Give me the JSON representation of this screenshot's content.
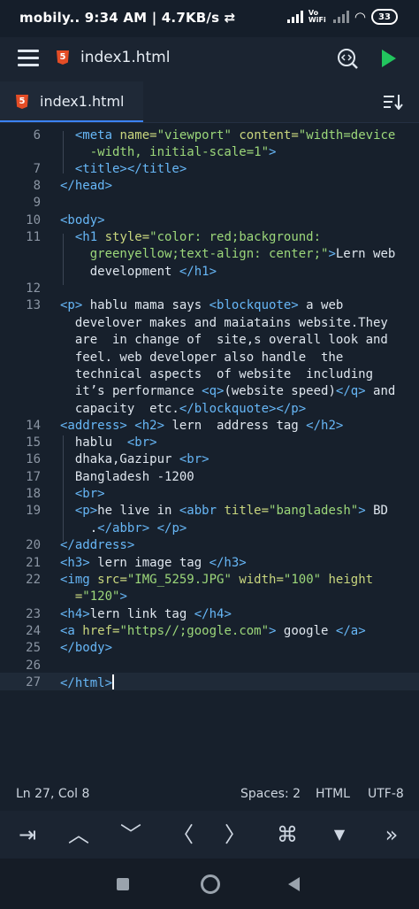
{
  "statusbar": {
    "carrier": "mobily..",
    "time": "9:34 AM",
    "speed": "4.7KB/s",
    "network": "Vo WiFi",
    "battery": "33"
  },
  "appbar": {
    "title": "index1.html",
    "icons": [
      "menu-icon",
      "html5-file-icon",
      "preview-icon",
      "run-icon"
    ]
  },
  "tabs": [
    {
      "label": "index1.html",
      "active": true
    }
  ],
  "editor": {
    "line_numbers": [
      "6",
      "7",
      "8",
      "9",
      "10",
      "11",
      "12",
      "13",
      "14",
      "15",
      "16",
      "17",
      "18",
      "19",
      "20",
      "21",
      "22",
      "23",
      "24",
      "25",
      "26",
      "27"
    ]
  },
  "statusline": {
    "position": "Ln 27, Col 8",
    "spaces": "Spaces: 2",
    "language": "HTML",
    "encoding": "UTF-8"
  },
  "keys": [
    "tab-key-icon",
    "arrow-up-icon",
    "arrow-down-icon",
    "arrow-left-icon",
    "arrow-right-icon",
    "command-key-icon",
    "dropdown-icon",
    "more-icon"
  ],
  "colors": {
    "tag": "#67b7f7",
    "attribute": "#c9d67e",
    "string": "#9cd77a",
    "background": "#17202c",
    "accent": "#3b82f6",
    "run": "#22c55e"
  }
}
